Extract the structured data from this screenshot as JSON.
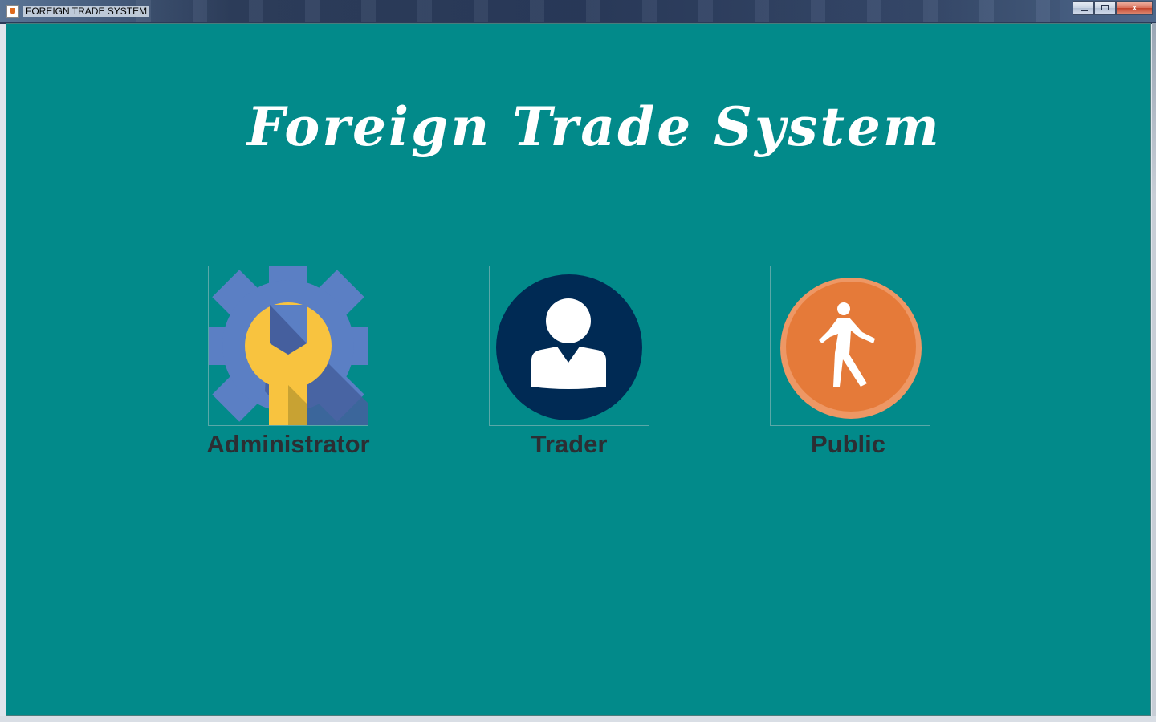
{
  "window": {
    "title": "FOREIGN TRADE SYSTEM",
    "controls": {
      "close_glyph": "x"
    }
  },
  "main": {
    "heading": "Foreign Trade System",
    "roles": [
      {
        "label": "Administrator",
        "icon": "settings-wrench-icon"
      },
      {
        "label": "Trader",
        "icon": "user-icon"
      },
      {
        "label": "Public",
        "icon": "walking-person-icon"
      }
    ]
  },
  "colors": {
    "background": "#028a8a",
    "heading": "#ffffff",
    "label": "#2c2e33",
    "gear": "#5b7fc4",
    "wrench": "#f8c33f",
    "trader_circle": "#002a54",
    "public_circle": "#e57a39"
  }
}
